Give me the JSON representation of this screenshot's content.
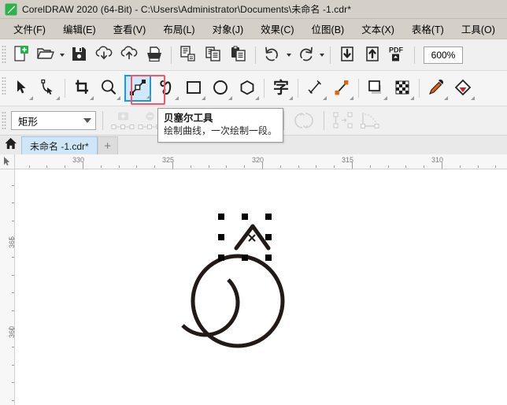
{
  "window": {
    "title": "CorelDRAW 2020 (64-Bit) - C:\\Users\\Administrator\\Documents\\未命名 -1.cdr*",
    "logo_icon": "coreldraw-balloon-icon"
  },
  "menubar": {
    "items": [
      {
        "label": "文件(F)",
        "name": "menu-file"
      },
      {
        "label": "编辑(E)",
        "name": "menu-edit"
      },
      {
        "label": "查看(V)",
        "name": "menu-view"
      },
      {
        "label": "布局(L)",
        "name": "menu-layout"
      },
      {
        "label": "对象(J)",
        "name": "menu-object"
      },
      {
        "label": "效果(C)",
        "name": "menu-effects"
      },
      {
        "label": "位图(B)",
        "name": "menu-bitmap"
      },
      {
        "label": "文本(X)",
        "name": "menu-text"
      },
      {
        "label": "表格(T)",
        "name": "menu-table"
      },
      {
        "label": "工具(O)",
        "name": "menu-tools"
      }
    ]
  },
  "toolbar": {
    "zoom_level": "600%",
    "buttons": [
      "new-document-icon",
      "open-document-icon",
      "save-icon",
      "import-cloud-icon",
      "export-cloud-icon",
      "print-icon",
      "publish-pdf-list-icon",
      "copy-icon",
      "paste-icon",
      "undo-icon",
      "redo-icon",
      "import-icon",
      "export-icon",
      "publish-pdf-icon"
    ]
  },
  "toolbox": {
    "selected_tool": "bezier-tool",
    "highlight_color": "#f4566a",
    "selection_color": "#1a9bdc",
    "tools": [
      {
        "name": "pick-tool",
        "label": "选择工具"
      },
      {
        "name": "shape-tool",
        "label": "形状工具"
      },
      {
        "name": "crop-tool",
        "label": "裁剪工具"
      },
      {
        "name": "zoom-tool",
        "label": "缩放工具"
      },
      {
        "name": "bezier-tool",
        "label": "贝塞尔工具"
      },
      {
        "name": "artistic-media-tool",
        "label": "艺术笔工具"
      },
      {
        "name": "rectangle-tool",
        "label": "矩形工具"
      },
      {
        "name": "ellipse-tool",
        "label": "椭圆形工具"
      },
      {
        "name": "polygon-tool",
        "label": "多边形工具"
      },
      {
        "name": "text-tool",
        "label": "文本工具"
      },
      {
        "name": "parallel-dimension-tool",
        "label": "平行度量工具"
      },
      {
        "name": "straight-line-connector-tool",
        "label": "直线连接器工具"
      },
      {
        "name": "drop-shadow-tool",
        "label": "阴影工具"
      },
      {
        "name": "transparency-tool",
        "label": "透明度工具"
      },
      {
        "name": "color-eyedropper-tool",
        "label": "颜色滴管工具"
      },
      {
        "name": "interactive-fill-tool",
        "label": "交互式填充工具"
      }
    ]
  },
  "tooltip": {
    "title": "贝塞尔工具",
    "description": "绘制曲线，一次绘制一段。"
  },
  "propertybar": {
    "shape_combo_value": "矩形",
    "shape_combo_placeholder": "矩形",
    "buttons": [
      {
        "name": "add-node-button",
        "enabled": false
      },
      {
        "name": "delete-node-button",
        "enabled": false
      },
      {
        "name": "join-nodes-button",
        "enabled": false
      },
      {
        "name": "break-curve-button",
        "enabled": false
      },
      {
        "name": "convert-to-line-button",
        "enabled": false
      },
      {
        "name": "convert-to-curve-button",
        "enabled": false
      },
      {
        "name": "make-node-cusp-button",
        "enabled": false
      },
      {
        "name": "make-node-smooth-button",
        "enabled": false
      },
      {
        "name": "make-node-symmetric-button",
        "enabled": false
      },
      {
        "name": "reverse-direction-button",
        "enabled": false
      },
      {
        "name": "extend-curve-to-close-button",
        "enabled": false
      },
      {
        "name": "auto-close-curve-button",
        "enabled": false
      }
    ]
  },
  "tabbar": {
    "home_icon": "home-icon",
    "document_tab": "未命名 -1.cdr*",
    "add_tab_label": "+"
  },
  "rulers": {
    "unit": "mm",
    "horizontal_labels": [
      "330",
      "325",
      "320",
      "315",
      "310"
    ],
    "vertical_labels": [
      "365",
      "360"
    ]
  },
  "canvas": {
    "stroke_color": "#221a17",
    "objects": [
      {
        "name": "circle-outline",
        "type": "circle"
      },
      {
        "name": "inner-arc",
        "type": "arc"
      },
      {
        "name": "chevron-path",
        "type": "path",
        "selected": true
      }
    ],
    "selection_handle_count": 8
  }
}
